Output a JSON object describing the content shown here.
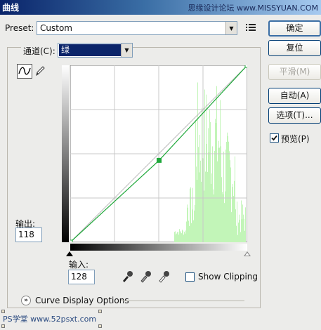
{
  "window": {
    "title": "曲线",
    "watermark": "思缘设计论坛 www.MISSYUAN.COM",
    "bottom_watermark": "PS学堂 www.52psxt.com"
  },
  "preset": {
    "label": "Preset:",
    "value": "Custom"
  },
  "channel": {
    "label": "通道(C):",
    "value": "绿"
  },
  "output": {
    "label": "输出:",
    "value": "118"
  },
  "input": {
    "label": "输入:",
    "value": "128"
  },
  "show_clipping": {
    "label": "Show Clipping",
    "checked": false
  },
  "curve_display_options": {
    "label": "Curve Display Options"
  },
  "buttons": {
    "ok": "确定",
    "reset": "复位",
    "smooth": "平滑(M)",
    "auto": "自动(A)",
    "options": "选项(T)...",
    "preview": "预览(P)"
  },
  "preview": {
    "checked": true
  },
  "icons": {
    "curve_tool": "curve-tool-icon",
    "pencil_tool": "pencil-icon",
    "black_eyedropper": "black-point-eyedropper-icon",
    "gray_eyedropper": "gray-point-eyedropper-icon",
    "white_eyedropper": "white-point-eyedropper-icon",
    "expand": "chevron-double-down-icon",
    "preset_options": "preset-options-icon"
  },
  "colors": {
    "curve": "#1fa83a",
    "histogram": "#c2f5b8",
    "grid": "#c8c8c8",
    "selection": "#0a246a"
  },
  "curve": {
    "points": [
      [
        0,
        0
      ],
      [
        128,
        118
      ],
      [
        255,
        255
      ]
    ]
  },
  "histogram": {
    "note_free": [
      0,
      0,
      0,
      0,
      0,
      0,
      0,
      0,
      0,
      0,
      0,
      0,
      0,
      0,
      0,
      0,
      0,
      0,
      0,
      0,
      0,
      0,
      0,
      0,
      0,
      0,
      0,
      0,
      0,
      0,
      0,
      0,
      0,
      0,
      0,
      0,
      0,
      0,
      0,
      0,
      0,
      0,
      0,
      0,
      0,
      0,
      0,
      0,
      0,
      0,
      0,
      0,
      0,
      0,
      0,
      0,
      0,
      0,
      0,
      0,
      0,
      0,
      0,
      0,
      0,
      0,
      0,
      0,
      0,
      0,
      0,
      0,
      0,
      0,
      0,
      0,
      0,
      0,
      0,
      0,
      0,
      0,
      0,
      0,
      0,
      0,
      0,
      0,
      0,
      0,
      0,
      0,
      0,
      0,
      0,
      0,
      0,
      0,
      0,
      0,
      0,
      0,
      0,
      0,
      0,
      0,
      0,
      0,
      0,
      0,
      0,
      0,
      0,
      0,
      0,
      0,
      0,
      0,
      0,
      0,
      0,
      0,
      0,
      0,
      0,
      0,
      0,
      0,
      0,
      0,
      0,
      0,
      0,
      0,
      0,
      0,
      0,
      0,
      0,
      0,
      0,
      0,
      0,
      0,
      0,
      0,
      0,
      0,
      0,
      0,
      0,
      0,
      0,
      0,
      0,
      0,
      0,
      0,
      0,
      0,
      0,
      0,
      0,
      0,
      0,
      0,
      0,
      0,
      0,
      0,
      0,
      0,
      0,
      0,
      0,
      0,
      0,
      0,
      0,
      0,
      0,
      0,
      0,
      0,
      0,
      0,
      0,
      0,
      0,
      0,
      0,
      0,
      0,
      0,
      0,
      0,
      0,
      0,
      0,
      0,
      0,
      0,
      0,
      0,
      0,
      0,
      0,
      0,
      0,
      0,
      0,
      0,
      0,
      0,
      0,
      0,
      0,
      0,
      0,
      0,
      0,
      0,
      0,
      0,
      0,
      0,
      0,
      0,
      0,
      0,
      0,
      0,
      0,
      0,
      0,
      0,
      0,
      0,
      0,
      0,
      0,
      0,
      0,
      0,
      0,
      0,
      0,
      0,
      0,
      0,
      0,
      0,
      0,
      0,
      0,
      0,
      0
    ]
  }
}
